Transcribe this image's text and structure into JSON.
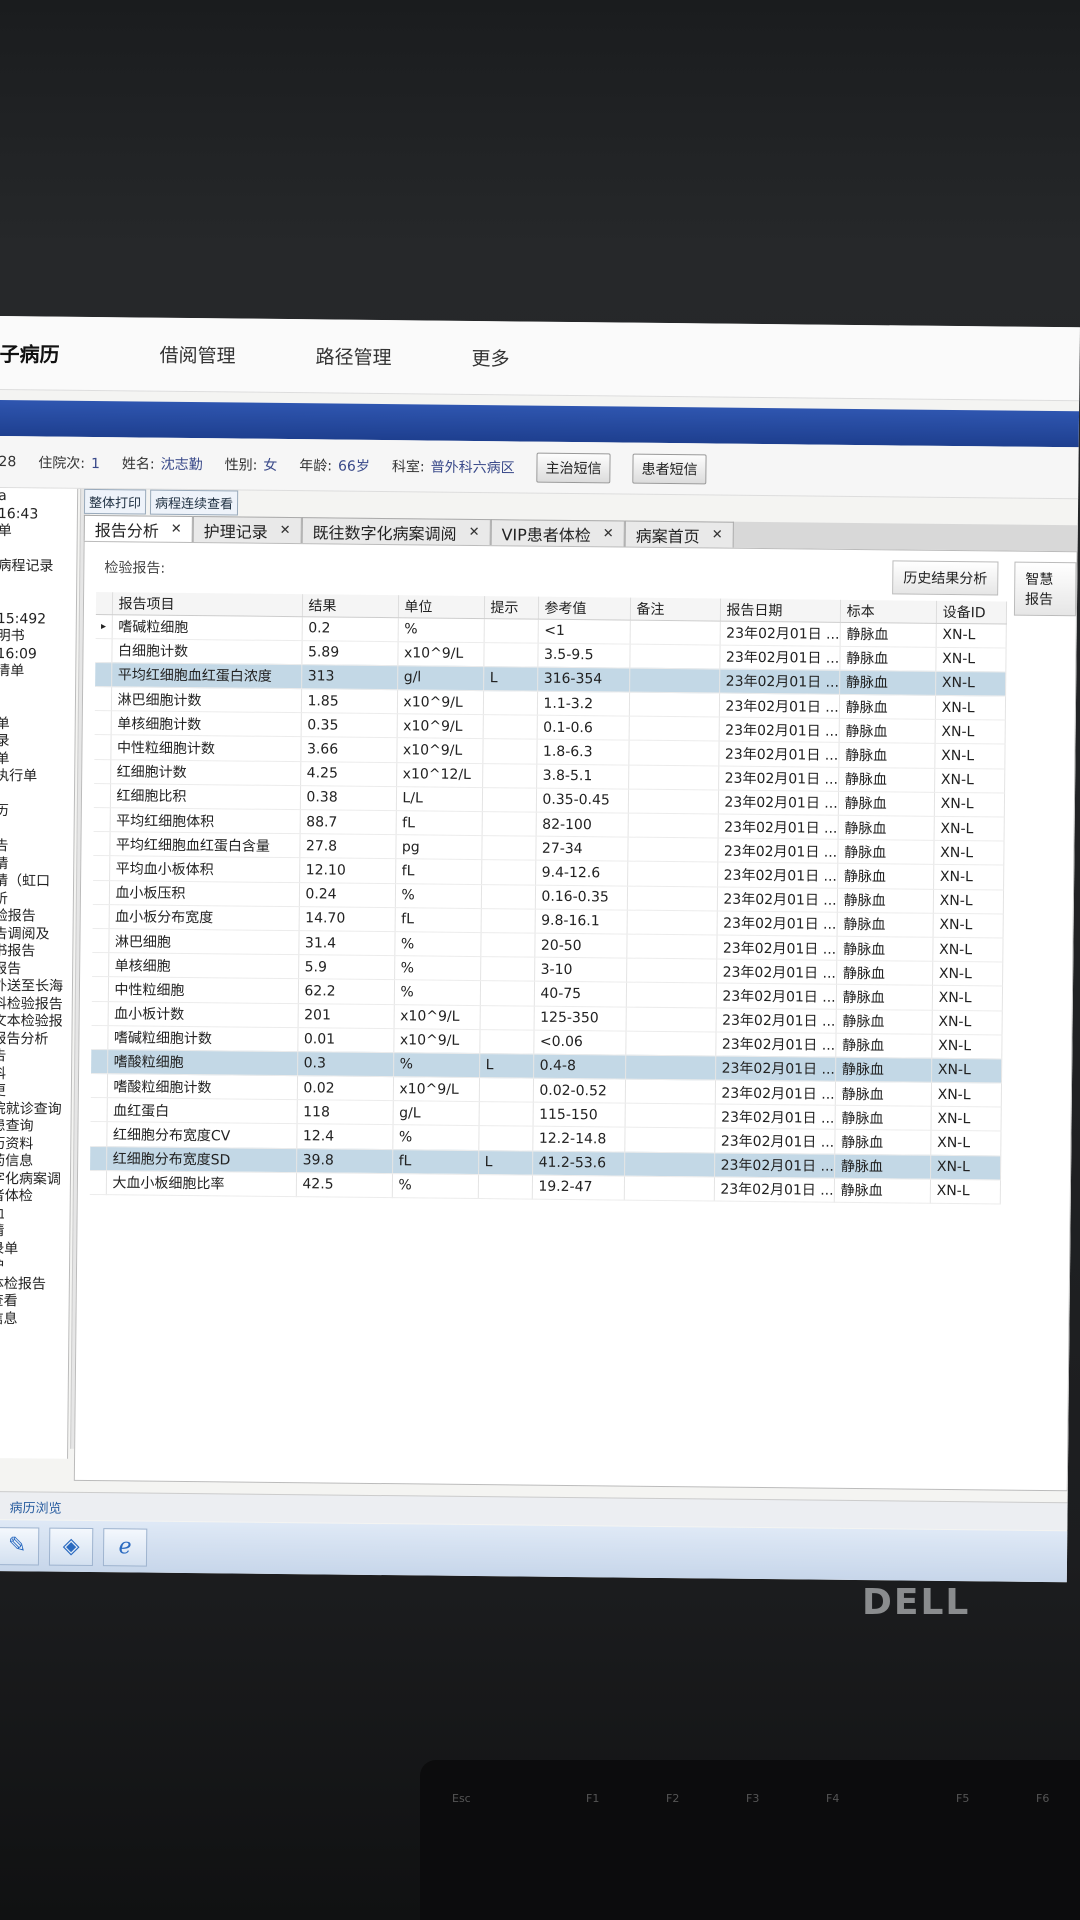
{
  "topnav": {
    "brand": "子病历",
    "items": [
      "借阅管理",
      "路径管理",
      "更多"
    ]
  },
  "patient": {
    "bed_suffix": "28",
    "visits_label": "住院次:",
    "visits": "1",
    "name_label": "姓名:",
    "name": "沈志勤",
    "sex_label": "性别:",
    "sex": "女",
    "age_label": "年龄:",
    "age": "66岁",
    "dept_label": "科室:",
    "dept": "普外科六病区",
    "btn_doctor_sms": "主治短信",
    "btn_patient_sms": "患者短信"
  },
  "left_panel": [
    "a",
    "16:43",
    "单",
    "",
    "病程记录",
    "",
    "",
    "15:492",
    "明书",
    "16:09",
    "清单",
    "",
    "",
    "单",
    "录",
    "单",
    "执行单",
    "",
    "历",
    "",
    "告",
    "请",
    "请（虹口",
    "析",
    "验报告",
    "告调阅及",
    "书报告",
    "报告",
    "外送至长海",
    "科检验报告",
    "文本检验报",
    "报告分析",
    "告",
    "科",
    "更",
    "院就诊查询",
    "患查询",
    "历资料",
    "药信息",
    "字化病案调",
    "者体检",
    "血",
    "请",
    "录单",
    "护",
    "体检报告",
    "查看",
    "信息"
  ],
  "toolbar": {
    "print_all": "整体打印",
    "progress_view": "病程连续查看"
  },
  "tabs": [
    {
      "label": "报告分析",
      "active": true
    },
    {
      "label": "护理记录",
      "active": false
    },
    {
      "label": "既往数字化病案调阅",
      "active": false
    },
    {
      "label": "VIP患者体检",
      "active": false
    },
    {
      "label": "病案首页",
      "active": false
    }
  ],
  "panel": {
    "section_label": "检验报告:",
    "btn_history": "历史结果分析",
    "btn_smart": "智慧报告"
  },
  "table": {
    "headers": [
      "报告项目",
      "结果",
      "单位",
      "提示",
      "参考值",
      "备注",
      "报告日期",
      "标本",
      "设备ID"
    ],
    "rows": [
      [
        "嗜碱粒细胞",
        "0.2",
        "%",
        "",
        "<1",
        "",
        "23年02月01日 ...",
        "静脉血",
        "XN-L"
      ],
      [
        "白细胞计数",
        "5.89",
        "x10^9/L",
        "",
        "3.5-9.5",
        "",
        "23年02月01日 ...",
        "静脉血",
        "XN-L"
      ],
      [
        "平均红细胞血红蛋白浓度",
        "313",
        "g/l",
        "L",
        "316-354",
        "",
        "23年02月01日 ...",
        "静脉血",
        "XN-L"
      ],
      [
        "淋巴细胞计数",
        "1.85",
        "x10^9/L",
        "",
        "1.1-3.2",
        "",
        "23年02月01日 ...",
        "静脉血",
        "XN-L"
      ],
      [
        "单核细胞计数",
        "0.35",
        "x10^9/L",
        "",
        "0.1-0.6",
        "",
        "23年02月01日 ...",
        "静脉血",
        "XN-L"
      ],
      [
        "中性粒细胞计数",
        "3.66",
        "x10^9/L",
        "",
        "1.8-6.3",
        "",
        "23年02月01日 ...",
        "静脉血",
        "XN-L"
      ],
      [
        "红细胞计数",
        "4.25",
        "x10^12/L",
        "",
        "3.8-5.1",
        "",
        "23年02月01日 ...",
        "静脉血",
        "XN-L"
      ],
      [
        "红细胞比积",
        "0.38",
        "L/L",
        "",
        "0.35-0.45",
        "",
        "23年02月01日 ...",
        "静脉血",
        "XN-L"
      ],
      [
        "平均红细胞体积",
        "88.7",
        "fL",
        "",
        "82-100",
        "",
        "23年02月01日 ...",
        "静脉血",
        "XN-L"
      ],
      [
        "平均红细胞血红蛋白含量",
        "27.8",
        "pg",
        "",
        "27-34",
        "",
        "23年02月01日 ...",
        "静脉血",
        "XN-L"
      ],
      [
        "平均血小板体积",
        "12.10",
        "fL",
        "",
        "9.4-12.6",
        "",
        "23年02月01日 ...",
        "静脉血",
        "XN-L"
      ],
      [
        "血小板压积",
        "0.24",
        "%",
        "",
        "0.16-0.35",
        "",
        "23年02月01日 ...",
        "静脉血",
        "XN-L"
      ],
      [
        "血小板分布宽度",
        "14.70",
        "fL",
        "",
        "9.8-16.1",
        "",
        "23年02月01日 ...",
        "静脉血",
        "XN-L"
      ],
      [
        "淋巴细胞",
        "31.4",
        "%",
        "",
        "20-50",
        "",
        "23年02月01日 ...",
        "静脉血",
        "XN-L"
      ],
      [
        "单核细胞",
        "5.9",
        "%",
        "",
        "3-10",
        "",
        "23年02月01日 ...",
        "静脉血",
        "XN-L"
      ],
      [
        "中性粒细胞",
        "62.2",
        "%",
        "",
        "40-75",
        "",
        "23年02月01日 ...",
        "静脉血",
        "XN-L"
      ],
      [
        "血小板计数",
        "201",
        "x10^9/L",
        "",
        "125-350",
        "",
        "23年02月01日 ...",
        "静脉血",
        "XN-L"
      ],
      [
        "嗜碱粒细胞计数",
        "0.01",
        "x10^9/L",
        "",
        "<0.06",
        "",
        "23年02月01日 ...",
        "静脉血",
        "XN-L"
      ],
      [
        "嗜酸粒细胞",
        "0.3",
        "%",
        "L",
        "0.4-8",
        "",
        "23年02月01日 ...",
        "静脉血",
        "XN-L"
      ],
      [
        "嗜酸粒细胞计数",
        "0.02",
        "x10^9/L",
        "",
        "0.02-0.52",
        "",
        "23年02月01日 ...",
        "静脉血",
        "XN-L"
      ],
      [
        "血红蛋白",
        "118",
        "g/L",
        "",
        "115-150",
        "",
        "23年02月01日 ...",
        "静脉血",
        "XN-L"
      ],
      [
        "红细胞分布宽度CV",
        "12.4",
        "%",
        "",
        "12.2-14.8",
        "",
        "23年02月01日 ...",
        "静脉血",
        "XN-L"
      ],
      [
        "红细胞分布宽度SD",
        "39.8",
        "fL",
        "L",
        "41.2-53.6",
        "",
        "23年02月01日 ...",
        "静脉血",
        "XN-L"
      ],
      [
        "大血小板细胞比率",
        "42.5",
        "%",
        "",
        "19.2-47",
        "",
        "23年02月01日 ...",
        "静脉血",
        "XN-L"
      ]
    ]
  },
  "statusbar": {
    "tab": "病历浏览"
  },
  "taskbar": {
    "icons": [
      "tools-icon",
      "app-icon",
      "ie-icon"
    ]
  },
  "monitor": {
    "brand": "DELL"
  },
  "keyboard": {
    "keys": [
      "Esc",
      "F1",
      "F2",
      "F3",
      "F4",
      "F5",
      "F6"
    ]
  }
}
